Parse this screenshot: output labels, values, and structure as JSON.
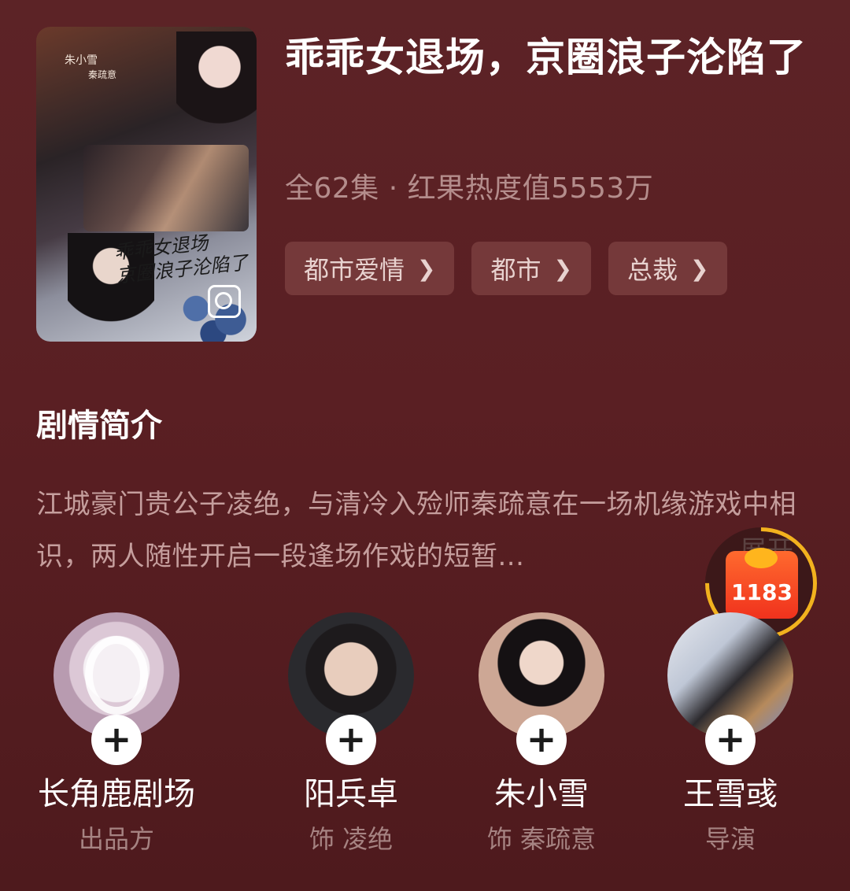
{
  "drama": {
    "title": "乖乖女退场，京圈浪子沦陷了",
    "meta": "全62集 · 红果热度值5553万",
    "tags": [
      {
        "label": "都市爱情"
      },
      {
        "label": "都市"
      },
      {
        "label": "总裁"
      }
    ],
    "poster": {
      "cast_note_line1": "朱小雪",
      "cast_note_line2": "秦疏意",
      "calligraphy_line1": "乖乖女退场",
      "calligraphy_line2": "京圈浪子沦陷了"
    }
  },
  "synopsis": {
    "heading": "剧情简介",
    "text": "江城豪门贵公子凌绝，与清冷入殓师秦疏意在一场机缘游戏中相识，两人随性开启一段逢场作戏的短暂...",
    "expand_label": "展开"
  },
  "reward": {
    "count": "1183"
  },
  "crew": [
    {
      "name": "长角鹿剧场",
      "role": "出品方"
    },
    {
      "name": "阳兵卓",
      "role": "饰 凌绝"
    },
    {
      "name": "朱小雪",
      "role": "饰 秦疏意"
    },
    {
      "name": "王雪彧",
      "role": "导演"
    }
  ]
}
